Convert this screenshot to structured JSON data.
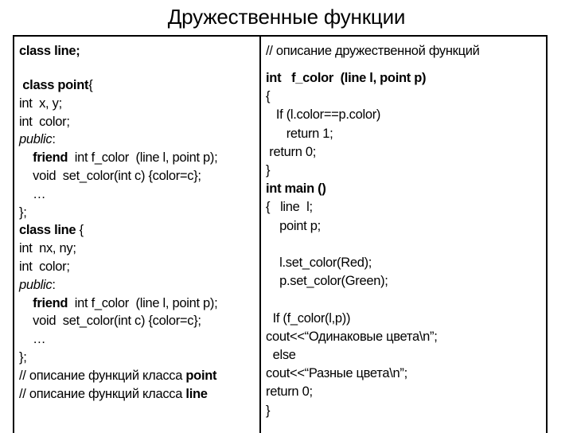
{
  "title": "Дружественные функции",
  "left_column": {
    "header": "class line;",
    "lines": [
      {
        "indent": " ",
        "parts": [
          {
            "t": "class point",
            "s": "b"
          },
          {
            "t": "{",
            "s": ""
          }
        ]
      },
      {
        "indent": "",
        "parts": [
          {
            "t": "int  x, y;",
            "s": ""
          }
        ]
      },
      {
        "indent": "",
        "parts": [
          {
            "t": "int  color;",
            "s": ""
          }
        ]
      },
      {
        "indent": "",
        "parts": [
          {
            "t": "public",
            "s": "i"
          },
          {
            "t": ":",
            "s": ""
          }
        ]
      },
      {
        "indent": "    ",
        "parts": [
          {
            "t": "friend",
            "s": "b"
          },
          {
            "t": "  int f_color  (line l, point p);",
            "s": ""
          }
        ]
      },
      {
        "indent": "    ",
        "parts": [
          {
            "t": "void  set_color(int c) {color=c};",
            "s": ""
          }
        ]
      },
      {
        "indent": "    ",
        "parts": [
          {
            "t": "…",
            "s": ""
          }
        ]
      },
      {
        "indent": "",
        "parts": [
          {
            "t": "};",
            "s": ""
          }
        ]
      },
      {
        "indent": "",
        "parts": [
          {
            "t": "class line",
            "s": "b"
          },
          {
            "t": " {",
            "s": ""
          }
        ]
      },
      {
        "indent": "",
        "parts": [
          {
            "t": "int  nx, ny;",
            "s": ""
          }
        ]
      },
      {
        "indent": "",
        "parts": [
          {
            "t": "int  color;",
            "s": ""
          }
        ]
      },
      {
        "indent": "",
        "parts": [
          {
            "t": "public",
            "s": "i"
          },
          {
            "t": ":",
            "s": ""
          }
        ]
      },
      {
        "indent": "    ",
        "parts": [
          {
            "t": "friend",
            "s": "b"
          },
          {
            "t": "  int f_color  (line l, point p);",
            "s": ""
          }
        ]
      },
      {
        "indent": "    ",
        "parts": [
          {
            "t": "void  set_color(int c) {color=c};",
            "s": ""
          }
        ]
      },
      {
        "indent": "    ",
        "parts": [
          {
            "t": "…",
            "s": ""
          }
        ]
      },
      {
        "indent": "",
        "parts": [
          {
            "t": "};",
            "s": ""
          }
        ]
      },
      {
        "indent": "",
        "parts": [
          {
            "t": "// описание функций класса ",
            "s": ""
          },
          {
            "t": "point",
            "s": "b"
          }
        ]
      },
      {
        "indent": "",
        "parts": [
          {
            "t": "// описание функций класса ",
            "s": ""
          },
          {
            "t": "line",
            "s": "b"
          }
        ]
      }
    ]
  },
  "right_column": {
    "header": "// описание дружественной функций",
    "lines": [
      {
        "indent": "",
        "parts": [
          {
            "t": "int   f_color  (line l, point p)",
            "s": "b"
          }
        ]
      },
      {
        "indent": "",
        "parts": [
          {
            "t": "{",
            "s": ""
          }
        ]
      },
      {
        "indent": "   ",
        "parts": [
          {
            "t": "If (l.color==p.color)",
            "s": ""
          }
        ]
      },
      {
        "indent": "      ",
        "parts": [
          {
            "t": "return 1;",
            "s": ""
          }
        ]
      },
      {
        "indent": " ",
        "parts": [
          {
            "t": "return 0;",
            "s": ""
          }
        ]
      },
      {
        "indent": "",
        "parts": [
          {
            "t": "}",
            "s": ""
          }
        ]
      },
      {
        "indent": "",
        "parts": [
          {
            "t": "int main ()",
            "s": "b"
          }
        ]
      },
      {
        "indent": "",
        "parts": [
          {
            "t": "{   line  l;",
            "s": ""
          }
        ]
      },
      {
        "indent": "    ",
        "parts": [
          {
            "t": "point p;",
            "s": ""
          }
        ]
      },
      {
        "indent": "",
        "parts": []
      },
      {
        "indent": "    ",
        "parts": [
          {
            "t": "l.set_color(Red);",
            "s": ""
          }
        ]
      },
      {
        "indent": "    ",
        "parts": [
          {
            "t": "p.set_color(Green);",
            "s": ""
          }
        ]
      },
      {
        "indent": "",
        "parts": []
      },
      {
        "indent": "  ",
        "parts": [
          {
            "t": "If (f_color(l,p))",
            "s": ""
          }
        ]
      },
      {
        "indent": "",
        "parts": [
          {
            "t": "cout<<“Одинаковые цвета\\n”;",
            "s": ""
          }
        ]
      },
      {
        "indent": "  ",
        "parts": [
          {
            "t": "else",
            "s": ""
          }
        ]
      },
      {
        "indent": "",
        "parts": [
          {
            "t": "cout<<“Разные цвета\\n”;",
            "s": ""
          }
        ]
      },
      {
        "indent": "",
        "parts": [
          {
            "t": "return 0;",
            "s": ""
          }
        ]
      },
      {
        "indent": "",
        "parts": [
          {
            "t": "}",
            "s": ""
          }
        ]
      }
    ]
  }
}
